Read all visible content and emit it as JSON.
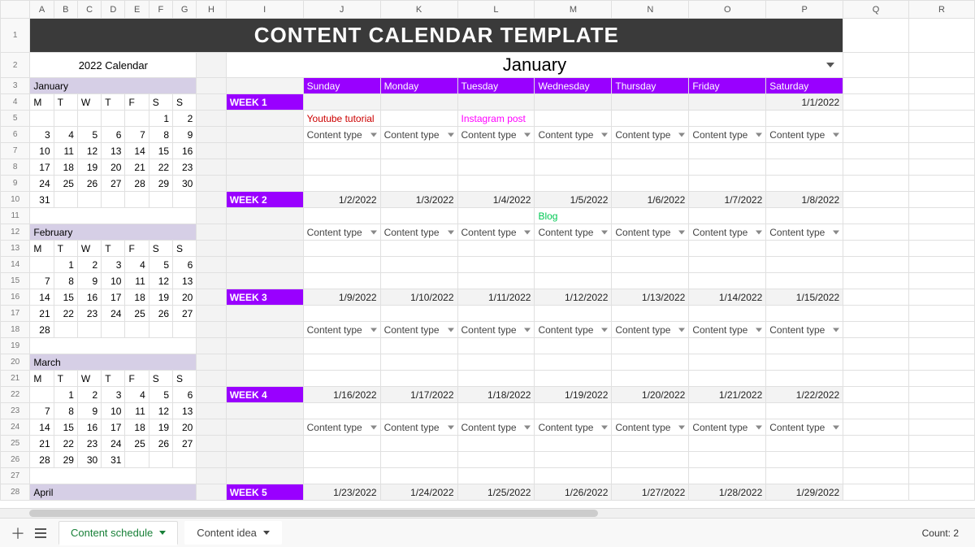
{
  "columns": [
    "A",
    "B",
    "C",
    "D",
    "E",
    "F",
    "G",
    "H",
    "I",
    "J",
    "K",
    "L",
    "M",
    "N",
    "O",
    "P",
    "Q",
    "R"
  ],
  "title": "CONTENT CALENDAR TEMPLATE",
  "sidebar_title": "2022 Calendar",
  "big_month": "January",
  "day_headers": [
    "Sunday",
    "Monday",
    "Tuesday",
    "Wednesday",
    "Thursday",
    "Friday",
    "Saturday"
  ],
  "weekday_letters": [
    "M",
    "T",
    "W",
    "T",
    "F",
    "S",
    "S"
  ],
  "mini_months": {
    "january": {
      "name": "January",
      "rows": [
        [
          "",
          "",
          "",
          "",
          "",
          "1",
          "2"
        ],
        [
          "3",
          "4",
          "5",
          "6",
          "7",
          "8",
          "9"
        ],
        [
          "10",
          "11",
          "12",
          "13",
          "14",
          "15",
          "16"
        ],
        [
          "17",
          "18",
          "19",
          "20",
          "21",
          "22",
          "23"
        ],
        [
          "24",
          "25",
          "26",
          "27",
          "28",
          "29",
          "30"
        ],
        [
          "31",
          "",
          "",
          "",
          "",
          "",
          ""
        ]
      ]
    },
    "february": {
      "name": "February",
      "rows": [
        [
          "",
          "1",
          "2",
          "3",
          "4",
          "5",
          "6"
        ],
        [
          "7",
          "8",
          "9",
          "10",
          "11",
          "12",
          "13"
        ],
        [
          "14",
          "15",
          "16",
          "17",
          "18",
          "19",
          "20"
        ],
        [
          "21",
          "22",
          "23",
          "24",
          "25",
          "26",
          "27"
        ],
        [
          "28",
          "",
          "",
          "",
          "",
          "",
          ""
        ]
      ]
    },
    "march": {
      "name": "March",
      "rows": [
        [
          "",
          "1",
          "2",
          "3",
          "4",
          "5",
          "6"
        ],
        [
          "7",
          "8",
          "9",
          "10",
          "11",
          "12",
          "13"
        ],
        [
          "14",
          "15",
          "16",
          "17",
          "18",
          "19",
          "20"
        ],
        [
          "21",
          "22",
          "23",
          "24",
          "25",
          "26",
          "27"
        ],
        [
          "28",
          "29",
          "30",
          "31",
          "",
          "",
          ""
        ]
      ]
    },
    "april": {
      "name": "April"
    }
  },
  "weeks": [
    {
      "label": "WEEK 1",
      "dates": [
        "",
        "",
        "",
        "",
        "",
        "",
        "1/1/2022"
      ]
    },
    {
      "label": "WEEK 2",
      "dates": [
        "1/2/2022",
        "1/3/2022",
        "1/4/2022",
        "1/5/2022",
        "1/6/2022",
        "1/7/2022",
        "1/8/2022"
      ]
    },
    {
      "label": "WEEK 3",
      "dates": [
        "1/9/2022",
        "1/10/2022",
        "1/11/2022",
        "1/12/2022",
        "1/13/2022",
        "1/14/2022",
        "1/15/2022"
      ]
    },
    {
      "label": "WEEK 4",
      "dates": [
        "1/16/2022",
        "1/17/2022",
        "1/18/2022",
        "1/19/2022",
        "1/20/2022",
        "1/21/2022",
        "1/22/2022"
      ]
    },
    {
      "label": "WEEK 5",
      "dates": [
        "1/23/2022",
        "1/24/2022",
        "1/25/2022",
        "1/26/2022",
        "1/27/2022",
        "1/28/2022",
        "1/29/2022"
      ]
    }
  ],
  "entries": {
    "w1": {
      "sun": "Youtube tutorial",
      "tue": "Instagram post"
    },
    "w2": {
      "wed": "Blog"
    }
  },
  "content_type_label": "Content type",
  "tabs": {
    "active": "Content schedule",
    "other": "Content idea"
  },
  "status": {
    "count": "Count: 2"
  }
}
